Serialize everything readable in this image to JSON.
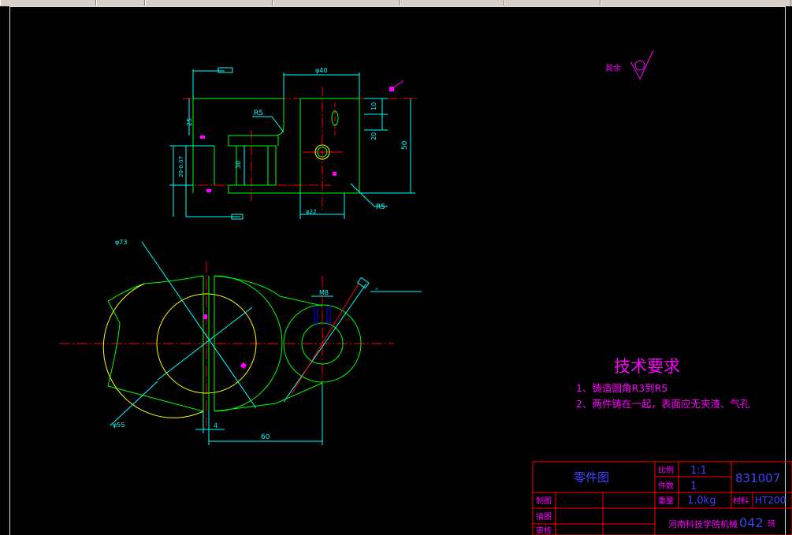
{
  "roughness": {
    "label": "其余"
  },
  "dimensions": {
    "d40": "φ40",
    "d10": "10",
    "d20": "20",
    "d50": "50",
    "d25": "25",
    "d30": "30",
    "r5_top": "R5",
    "r5_bottom": "R5",
    "d20_left": "20-0.07",
    "d22": "φ22",
    "d73": "φ73",
    "d55": "φ55",
    "d4": "4",
    "d60": "60",
    "m8": "M8"
  },
  "tech_requirements": {
    "title": "技术要求",
    "items": [
      "1、铸造圆角R3到R5",
      "2、两件铸在一起，表面应无夹渣、气孔"
    ]
  },
  "title_block": {
    "part_name": "零件图",
    "scale_label": "比例",
    "scale_value": "1:1",
    "qty_label": "件数",
    "qty_value": "1",
    "drawing_no": "831007",
    "weight_label": "重量",
    "weight_value": "1.0kg",
    "material_label": "材料",
    "material_value": "HT200",
    "designer_label": "制图",
    "checker_label": "描图",
    "reviewer_label": "审核",
    "school": "河南科技学院机械",
    "class_no": "042",
    "class_suffix": "班"
  },
  "colors": {
    "outline": "#00ff00",
    "dimension": "#00ffff",
    "center": "#ff0000",
    "text": "#ff00ff",
    "hidden": "#ffff00",
    "titleblock": "#ff0000",
    "tb_text": "#4040ff"
  }
}
